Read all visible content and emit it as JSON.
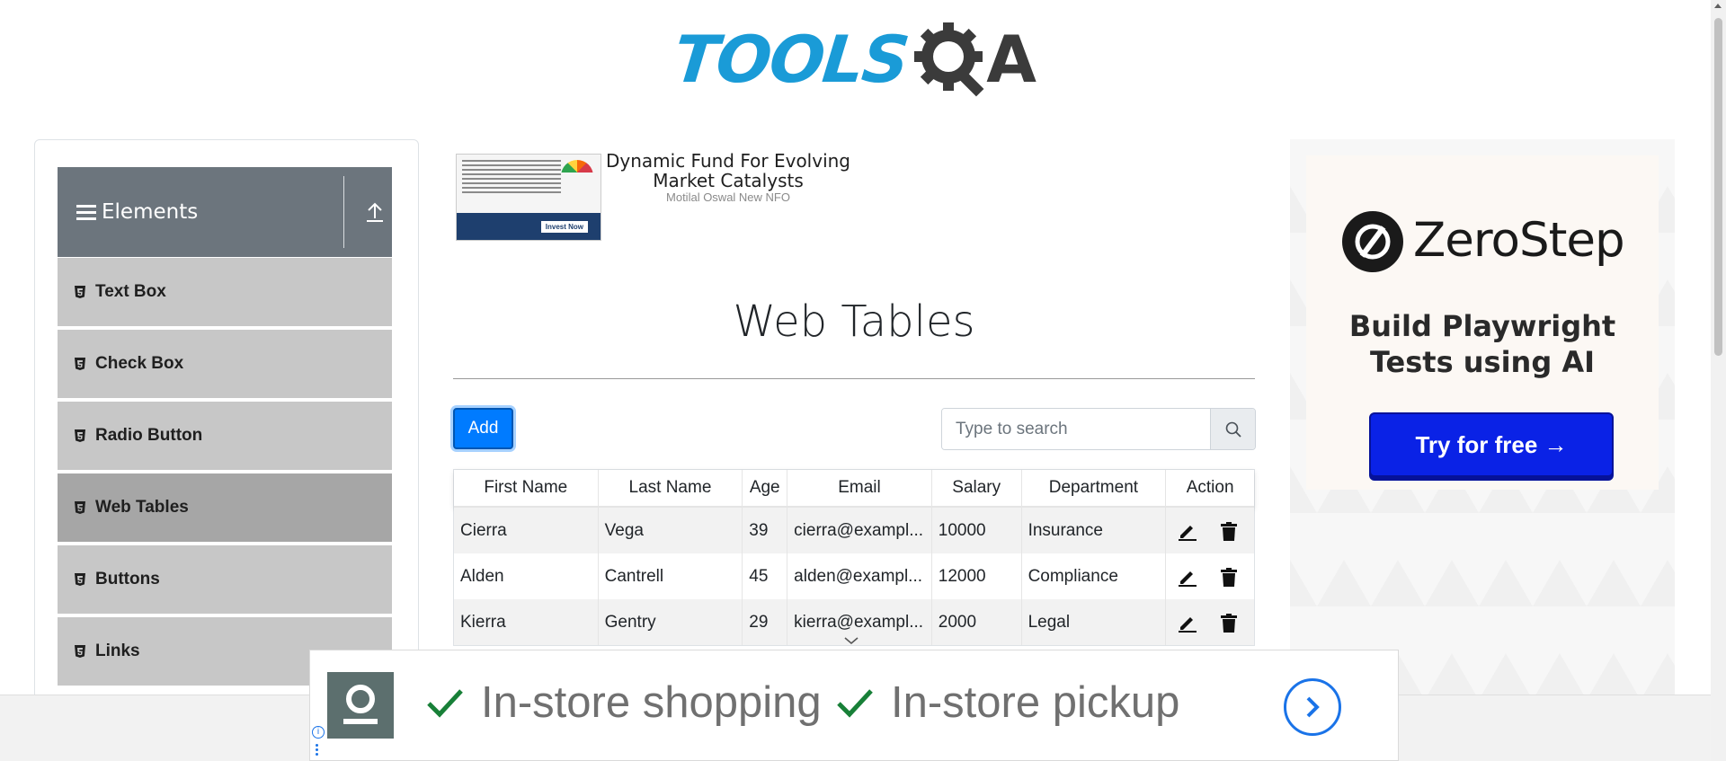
{
  "header": {
    "logo_text_left": "TOOLS",
    "logo_text_right": "A"
  },
  "sidebar": {
    "group_title": "Elements",
    "items": [
      {
        "label": "Text Box",
        "active": false
      },
      {
        "label": "Check Box",
        "active": false
      },
      {
        "label": "Radio Button",
        "active": false
      },
      {
        "label": "Web Tables",
        "active": true
      },
      {
        "label": "Buttons",
        "active": false
      },
      {
        "label": "Links",
        "active": false
      }
    ]
  },
  "top_ad": {
    "headline": "Dynamic Fund For Evolving Market Catalysts",
    "sponsor": "Motilal Oswal New NFO",
    "thumb_cta": "Invest Now"
  },
  "main": {
    "title": "Web Tables",
    "add_label": "Add",
    "search_placeholder": "Type to search",
    "columns": [
      "First Name",
      "Last Name",
      "Age",
      "Email",
      "Salary",
      "Department",
      "Action"
    ],
    "rows": [
      {
        "first": "Cierra",
        "last": "Vega",
        "age": "39",
        "email": "cierra@exampl...",
        "salary": "10000",
        "department": "Insurance"
      },
      {
        "first": "Alden",
        "last": "Cantrell",
        "age": "45",
        "email": "alden@exampl...",
        "salary": "12000",
        "department": "Compliance"
      },
      {
        "first": "Kierra",
        "last": "Gentry",
        "age": "29",
        "email": "kierra@exampl...",
        "salary": "2000",
        "department": "Legal"
      }
    ]
  },
  "right_ad": {
    "brand": "ZeroStep",
    "tagline": "Build Playwright Tests using AI",
    "cta": "Try for free →",
    "cta_color": "#0a22e6"
  },
  "bottom_ad": {
    "item1": "In-store shopping",
    "item2": "In-store pickup",
    "check_color": "#188038"
  },
  "colors": {
    "primary": "#007bff",
    "sidebar_header": "#6c757d",
    "menu_item": "#c7c7c7",
    "menu_item_active": "#a6a6a6"
  }
}
